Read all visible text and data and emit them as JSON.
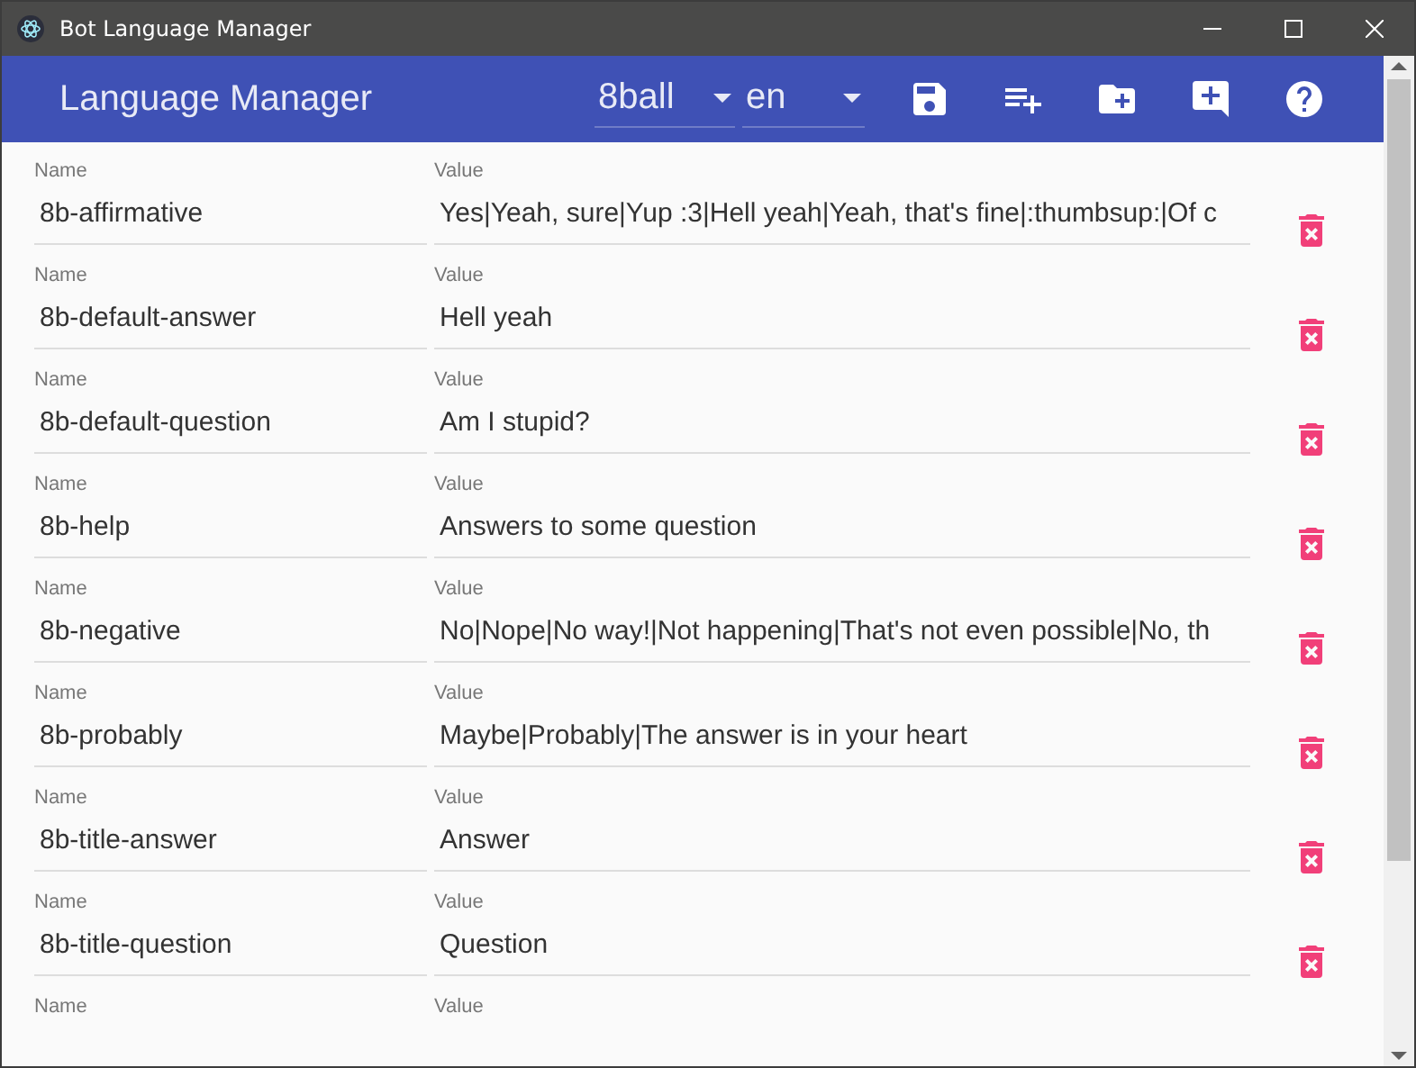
{
  "window": {
    "title": "Bot Language Manager"
  },
  "toolbar": {
    "title": "Language Manager",
    "bot_select": {
      "value": "8ball"
    },
    "language_select": {
      "value": "en"
    }
  },
  "entries": [
    {
      "name_label": "Name",
      "value_label": "Value",
      "name": "8b-affirmative",
      "value": "Yes|Yeah, sure|Yup :3|Hell yeah|Yeah, that's fine|:thumbsup:|Of c"
    },
    {
      "name_label": "Name",
      "value_label": "Value",
      "name": "8b-default-answer",
      "value": "Hell yeah"
    },
    {
      "name_label": "Name",
      "value_label": "Value",
      "name": "8b-default-question",
      "value": "Am I stupid?"
    },
    {
      "name_label": "Name",
      "value_label": "Value",
      "name": "8b-help",
      "value": "Answers to some question"
    },
    {
      "name_label": "Name",
      "value_label": "Value",
      "name": "8b-negative",
      "value": "No|Nope|No way!|Not happening|That's not even possible|No, th"
    },
    {
      "name_label": "Name",
      "value_label": "Value",
      "name": "8b-probably",
      "value": "Maybe|Probably|The answer is in your heart"
    },
    {
      "name_label": "Name",
      "value_label": "Value",
      "name": "8b-title-answer",
      "value": "Answer"
    },
    {
      "name_label": "Name",
      "value_label": "Value",
      "name": "8b-title-question",
      "value": "Question"
    },
    {
      "name_label": "Name",
      "value_label": "Value"
    }
  ]
}
